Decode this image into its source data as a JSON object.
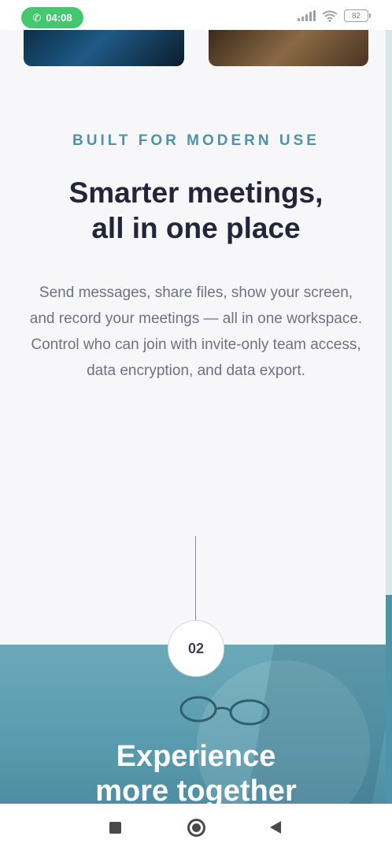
{
  "status_bar": {
    "call_time": "04:08",
    "battery": "82",
    "icons": [
      "phone-icon",
      "signal-icon",
      "wifi-icon",
      "battery-icon"
    ]
  },
  "section": {
    "eyebrow": "BUILT FOR MODERN USE",
    "headline_line1": "Smarter meetings,",
    "headline_line2": "all in one place",
    "body": "Send messages, share files, show your screen, and record your meetings — all in one workspace. Control who can join with invite-only team access, data encryption, and data export."
  },
  "step": {
    "number": "02"
  },
  "hero": {
    "title_line1": "Experience",
    "title_line2": "more together"
  },
  "nav": {
    "icons": [
      "recents-icon",
      "home-icon",
      "back-icon"
    ]
  },
  "colors": {
    "accent": "#4e93a7",
    "call_pill": "#45c671",
    "heading": "#24243a",
    "body_text": "#6f6f86"
  }
}
